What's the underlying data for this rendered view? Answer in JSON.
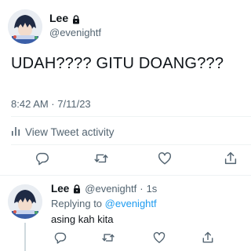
{
  "tweet": {
    "author": {
      "display_name": "Lee",
      "handle": "@evenightf",
      "protected": true
    },
    "text": "UDAH???? GITU DOANG???",
    "timestamp": "8:42 AM · 7/11/23",
    "activity_label": "View Tweet activity",
    "actions": [
      "reply-icon",
      "retweet-icon",
      "like-icon",
      "share-icon"
    ]
  },
  "reply": {
    "author": {
      "display_name": "Lee",
      "handle": "@evenightf",
      "dot": "·",
      "time": "1s"
    },
    "replying_to_prefix": "Replying to",
    "replying_to_handle": "@evenightf",
    "text": "asing kah kita"
  },
  "colors": {
    "text": "#0f1419",
    "secondary": "#536471",
    "link": "#1d9bf0",
    "divider": "#eff3f4"
  }
}
